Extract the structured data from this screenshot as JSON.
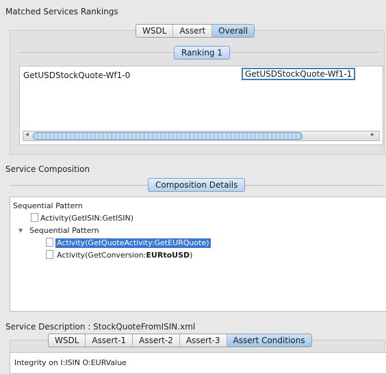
{
  "matched": {
    "title": "Matched Services Rankings",
    "tabs": [
      "WSDL",
      "Assert",
      "Overall"
    ],
    "selected_tab": "Overall",
    "ranking_label": "Ranking 1",
    "ranking_items": [
      "GetUSDStockQuote-Wf1-0",
      "GetUSDStockQuote-Wf1-1"
    ],
    "scroll_left_glyph": "◂",
    "scroll_right_glyph": "▸"
  },
  "composition": {
    "title": "Service Composition",
    "details_label": "Composition Details",
    "tree": {
      "root": "Sequential Pattern",
      "activity1": "Activity(GetISIN:GetISIN)",
      "sub_pattern": "Sequential Pattern",
      "activity2": "Activity(GetQuoteActivity:GetEURQuote)",
      "activity3_prefix": "Activity(GetConversion:",
      "activity3_bold": "EURtoUSD",
      "activity3_suffix": ")",
      "expand_glyph": "▼"
    }
  },
  "description": {
    "title": "Service Description : StockQuoteFromISIN.xml",
    "tabs": [
      "WSDL",
      "Assert-1",
      "Assert-2",
      "Assert-3",
      "Assert Conditions"
    ],
    "selected_tab": "Assert Conditions",
    "content": "Integrity on I:ISIN O:EURValue"
  }
}
